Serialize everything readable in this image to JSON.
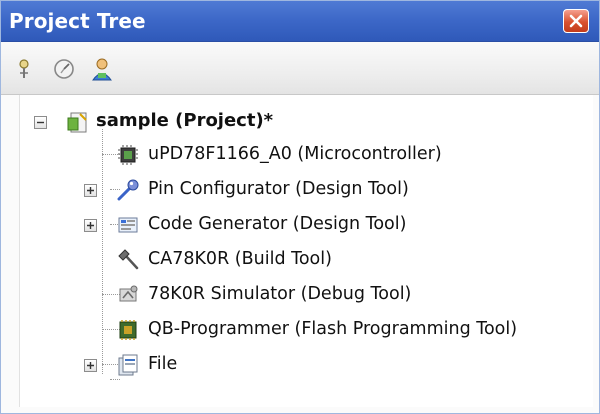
{
  "panel": {
    "title": "Project Tree"
  },
  "toolbar": {
    "buttons": [
      {
        "icon": "pin-icon"
      },
      {
        "icon": "clock-icon"
      },
      {
        "icon": "person-icon"
      }
    ]
  },
  "tree": {
    "root": {
      "label": "sample (Project)*",
      "icon": "project-icon",
      "expanded": true
    },
    "items": [
      {
        "label": "uPD78F1166_A0 (Microcontroller)",
        "icon": "chip-icon",
        "expandable": false
      },
      {
        "label": "Pin Configurator (Design Tool)",
        "icon": "pin-configurator-icon",
        "expandable": true
      },
      {
        "label": "Code Generator (Design Tool)",
        "icon": "code-generator-icon",
        "expandable": true
      },
      {
        "label": "CA78K0R (Build Tool)",
        "icon": "hammer-icon",
        "expandable": false
      },
      {
        "label": "78K0R Simulator (Debug Tool)",
        "icon": "simulator-icon",
        "expandable": false
      },
      {
        "label": "QB-Programmer (Flash Programming Tool)",
        "icon": "flash-programmer-icon",
        "expandable": false
      },
      {
        "label": "File",
        "icon": "file-folder-icon",
        "expandable": true
      }
    ]
  },
  "colors": {
    "titlebar": "#3c67c7",
    "close_button": "#d9512f",
    "toolbar": "#eeeeee"
  }
}
